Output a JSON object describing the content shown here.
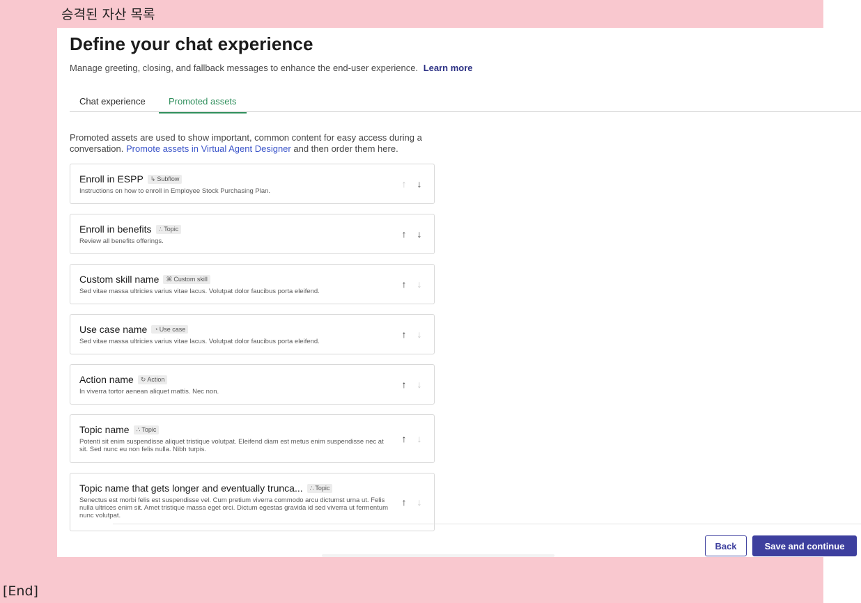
{
  "annotation": {
    "title": "승격된 자산 목록",
    "end": "[End]"
  },
  "header": {
    "title": "Define your chat experience",
    "subtitle": "Manage greeting, closing, and fallback messages to enhance the end-user experience.",
    "learn_more": "Learn more"
  },
  "tabs": [
    {
      "label": "Chat experience",
      "active": false
    },
    {
      "label": "Promoted assets",
      "active": true
    }
  ],
  "intro": {
    "text_before": "Promoted assets are used to show important, common content for easy access during a conversation.",
    "link": "Promote assets in Virtual Agent Designer",
    "text_after": "and then order them here."
  },
  "assets": [
    {
      "title": "Enroll in ESPP",
      "tag": "Subflow",
      "tag_icon": "subflow-icon",
      "description": "Instructions on how to enroll in Employee Stock Purchasing Plan.",
      "up_enabled": false,
      "down_enabled": true
    },
    {
      "title": "Enroll in benefits",
      "tag": "Topic",
      "tag_icon": "topic-icon",
      "description": "Review all benefits offerings.",
      "up_enabled": true,
      "down_enabled": true
    },
    {
      "title": "Custom skill name",
      "tag": "Custom skill",
      "tag_icon": "custom-skill-icon",
      "description": "Sed vitae massa ultricies varius vitae lacus. Volutpat dolor faucibus porta eleifend.",
      "up_enabled": true,
      "down_enabled": false
    },
    {
      "title": "Use case name",
      "tag": "Use case",
      "tag_icon": "use-case-icon",
      "description": "Sed vitae massa ultricies varius vitae lacus. Volutpat dolor faucibus porta eleifend.",
      "up_enabled": true,
      "down_enabled": false
    },
    {
      "title": "Action name",
      "tag": "Action",
      "tag_icon": "action-icon",
      "description": "In viverra tortor aenean aliquet mattis. Nec non.",
      "up_enabled": true,
      "down_enabled": false
    },
    {
      "title": "Topic name",
      "tag": "Topic",
      "tag_icon": "topic-icon",
      "description": "Potenti sit enim suspendisse aliquet tristique volutpat. Eleifend diam est metus enim suspendisse nec at sit. Sed nunc eu non felis nulla. Nibh turpis.",
      "up_enabled": true,
      "down_enabled": false
    },
    {
      "title": "Topic name that gets longer and eventually trunca...",
      "tag": "Topic",
      "tag_icon": "topic-icon",
      "description": "Senectus est morbi felis est suspendisse vel. Cum pretium viverra commodo arcu dictumst urna ut. Felis nulla ultrices enim sit. Amet tristique massa eget orci. Dictum egestas gravida id sed viverra ut fermentum nunc volutpat.",
      "up_enabled": true,
      "down_enabled": false
    }
  ],
  "footer": {
    "back_label": "Back",
    "save_label": "Save and continue"
  },
  "colors": {
    "annotation_bg": "#f9c8cf",
    "primary": "#3d3f9e",
    "active_tab": "#2f8f5c",
    "link": "#3a54c9"
  }
}
